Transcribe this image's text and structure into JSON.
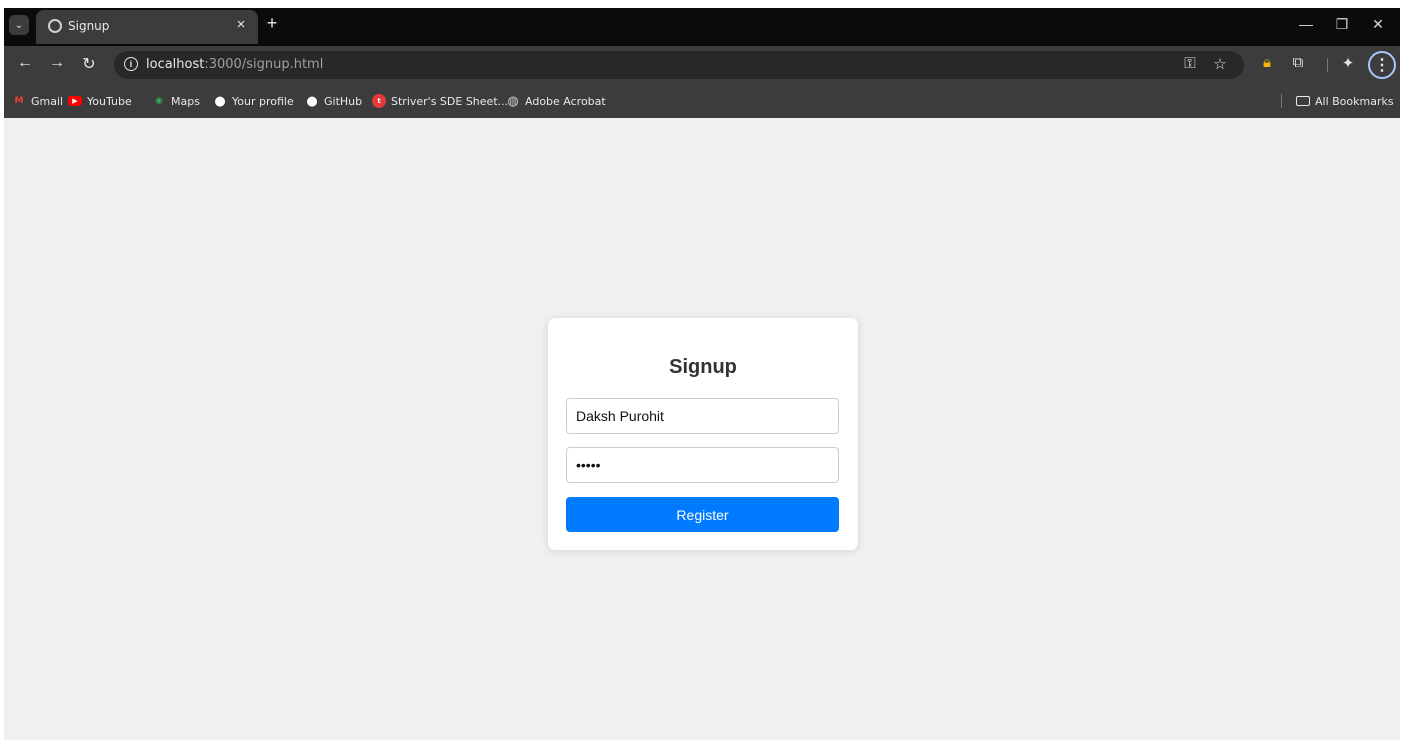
{
  "browser": {
    "tab": {
      "title": "Signup",
      "close": "×",
      "new_tab": "+"
    },
    "tab_search": "⌄",
    "window_controls": {
      "minimize": "—",
      "restore": "❐",
      "close": "✕"
    },
    "nav": {
      "back": "←",
      "forward": "→",
      "reload": "↻"
    },
    "url": {
      "host": "localhost",
      "path": ":3000/signup.html"
    },
    "bookmarks": [
      {
        "label": "Gmail",
        "icon": "gmail-icon",
        "glyph": "M",
        "color": "#ea4335"
      },
      {
        "label": "YouTube",
        "icon": "youtube-icon",
        "glyph": "▶",
        "color": "#ff0000"
      },
      {
        "label": "Maps",
        "icon": "maps-icon",
        "glyph": "◉",
        "color": "#34a853"
      },
      {
        "label": "Your profile",
        "icon": "github-icon",
        "glyph": "●",
        "color": "#ffffff"
      },
      {
        "label": "GitHub",
        "icon": "github-icon",
        "glyph": "●",
        "color": "#ffffff"
      },
      {
        "label": "Striver's SDE Sheet...",
        "icon": "tuf-icon",
        "glyph": "t",
        "color": "#e33b3b"
      },
      {
        "label": "Adobe Acrobat",
        "icon": "globe-icon",
        "glyph": "◍",
        "color": "#cccccc"
      }
    ],
    "all_bookmarks": "All Bookmarks",
    "accent_color": "#a8c7fa"
  },
  "signup": {
    "title": "Signup",
    "username_value": "Daksh Purohit",
    "password_value": "•••••",
    "register_label": "Register",
    "button_color": "#007bff"
  }
}
